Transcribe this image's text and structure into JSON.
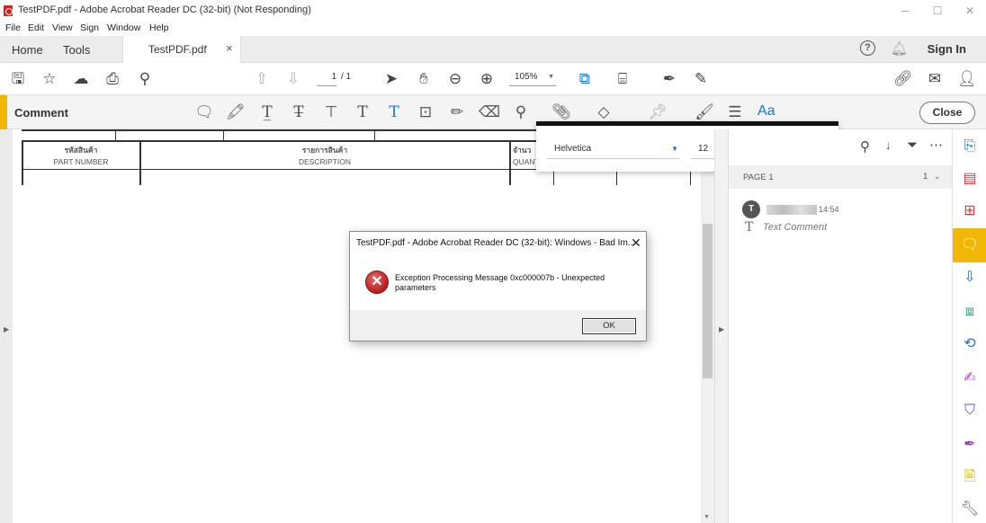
{
  "window": {
    "title": "TestPDF.pdf - Adobe Acrobat Reader DC (32-bit) (Not Responding)"
  },
  "menu": [
    "File",
    "Edit",
    "View",
    "Sign",
    "Window",
    "Help"
  ],
  "tabs": {
    "home": "Home",
    "tools": "Tools",
    "document": "TestPDF.pdf",
    "close_symbol": "×"
  },
  "header": {
    "sign_in": "Sign In"
  },
  "toolbar": {
    "page_current": "1",
    "page_total": "/ 1",
    "zoom": "105%"
  },
  "comment_bar": {
    "label": "Comment",
    "text_format": "Aa",
    "close": "Close"
  },
  "font_popover": {
    "font": "Helvetica",
    "size": "12",
    "color": "#000000"
  },
  "document": {
    "col1_thai": "รหัสสินค้า",
    "col1": "PART NUMBER",
    "col2_thai": "รายการสินค้า",
    "col2": "DESCRIPTION",
    "col3_thai": "จำนว",
    "col3": "QUANT"
  },
  "comments_panel": {
    "page_label": "PAGE 1",
    "page_count": "1",
    "comments": [
      {
        "avatar_letter": "T",
        "time": "14:54",
        "text": "Text Comment"
      }
    ]
  },
  "dialog": {
    "title": "TestPDF.pdf - Adobe Acrobat Reader DC (32-bit): Windows - Bad Im...",
    "message": "Exception Processing Message 0xc000007b - Unexpected parameters",
    "ok": "OK"
  }
}
